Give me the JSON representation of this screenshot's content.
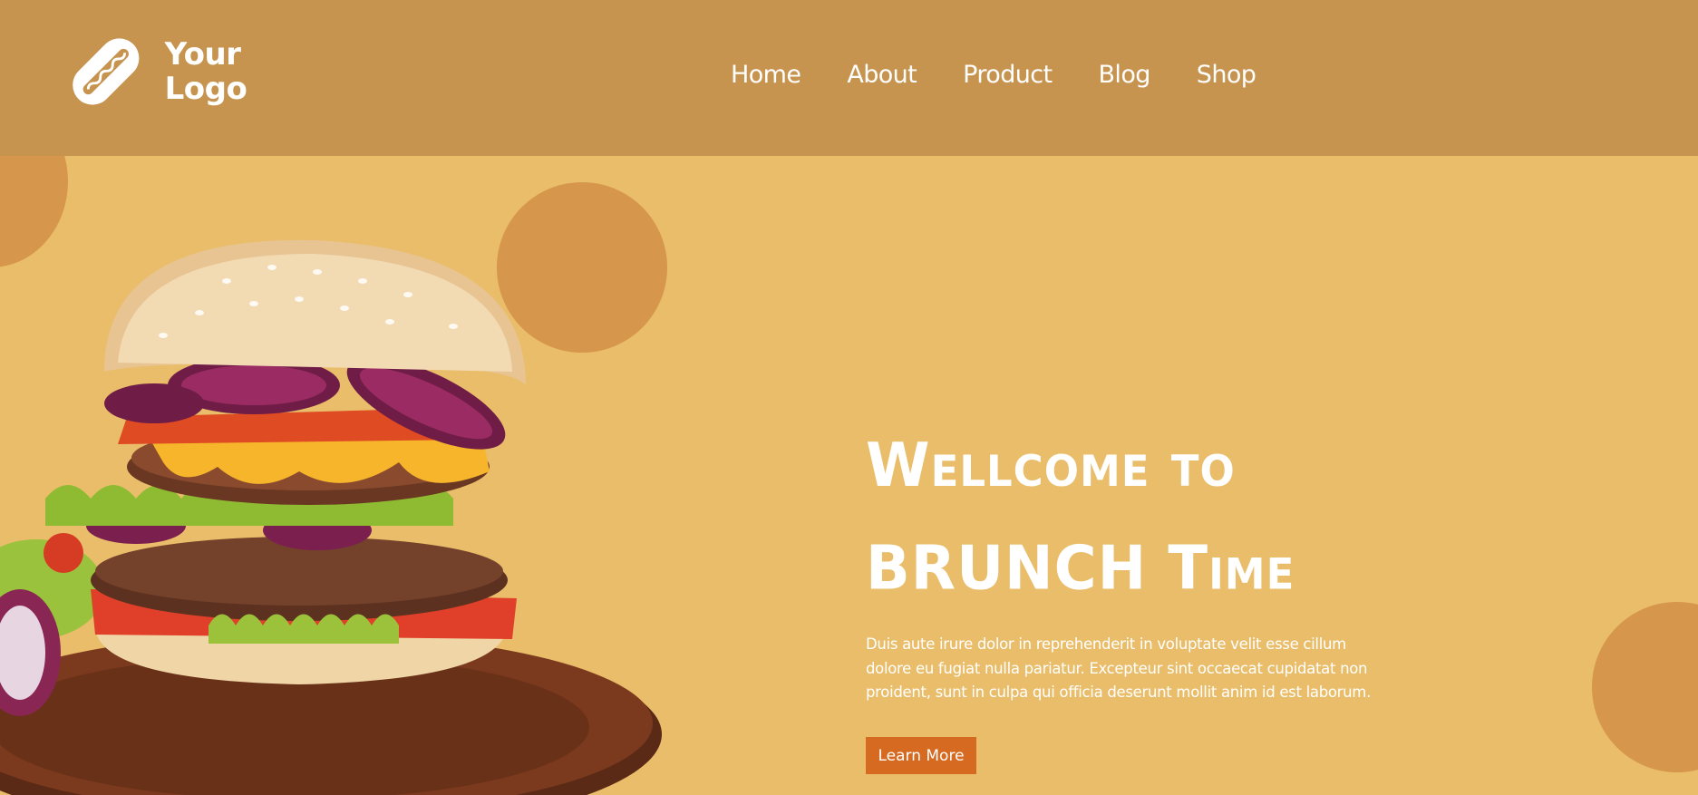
{
  "brand": {
    "logo_text": "Your Logo",
    "colors": {
      "header_bg": "#c7944f",
      "page_bg": "#e9bd69",
      "accent_circle": "#d6964c",
      "button_bg": "#d76a21",
      "text": "#ffffff"
    }
  },
  "nav": {
    "items": [
      {
        "label": "Home"
      },
      {
        "label": "About"
      },
      {
        "label": "Product"
      },
      {
        "label": "Blog"
      },
      {
        "label": "Shop"
      }
    ]
  },
  "hero": {
    "title_line1": "Wellcome to",
    "title_line2": "BRUNCH Time",
    "description": "Duis aute irure dolor in reprehenderit in voluptate velit esse cillum dolore eu fugiat nulla pariatur. Excepteur sint occaecat cupidatat non proident, sunt in culpa qui officia deserunt mollit anim id est laborum.",
    "button_label": "Learn More",
    "image_icon": "burger-image"
  }
}
